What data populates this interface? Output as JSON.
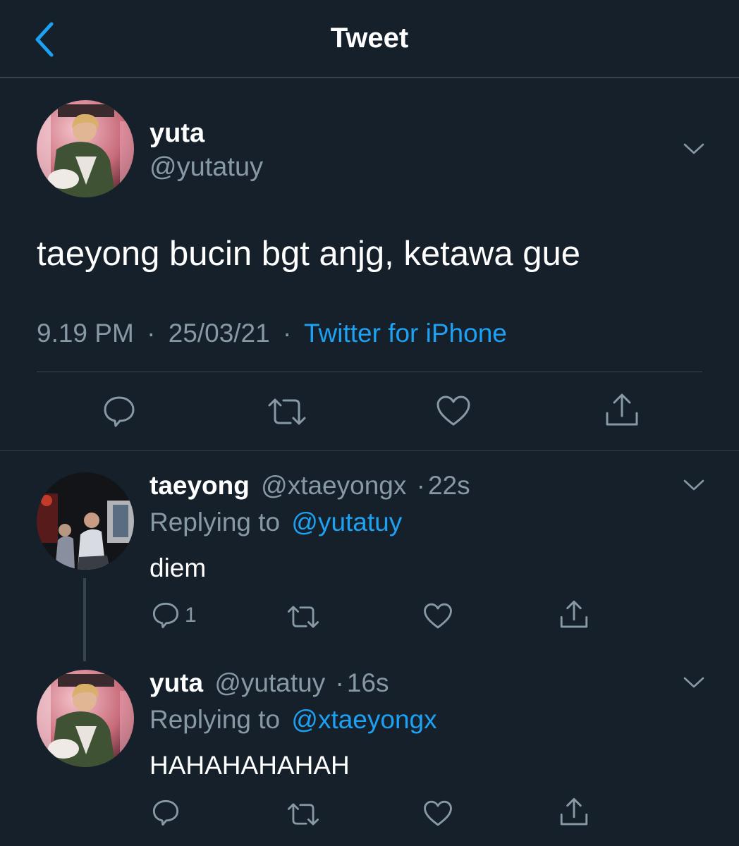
{
  "header": {
    "title": "Tweet",
    "back_icon": "chevron-left-icon"
  },
  "main_tweet": {
    "display_name": "yuta",
    "handle": "@yutatuy",
    "text": "taeyong bucin bgt anjg, ketawa gue",
    "time": "9.19 PM",
    "date": "25/03/21",
    "source": "Twitter for iPhone",
    "actions": [
      "reply-icon",
      "retweet-icon",
      "like-icon",
      "share-icon"
    ]
  },
  "replies": [
    {
      "display_name": "taeyong",
      "handle": "@xtaeyongx",
      "age": "22s",
      "replying_prefix": "Replying to",
      "replying_to": "@yutatuy",
      "text": "diem",
      "reply_count": "1"
    },
    {
      "display_name": "yuta",
      "handle": "@yutatuy",
      "age": "16s",
      "replying_prefix": "Replying to",
      "replying_to": "@xtaeyongx",
      "text": "HAHAHAHAHAH",
      "reply_count": ""
    }
  ],
  "separator": "·",
  "colors": {
    "background": "#15202b",
    "accent": "#1da1f2",
    "muted": "#8899a6",
    "divider": "#38444d",
    "text": "#ffffff"
  }
}
